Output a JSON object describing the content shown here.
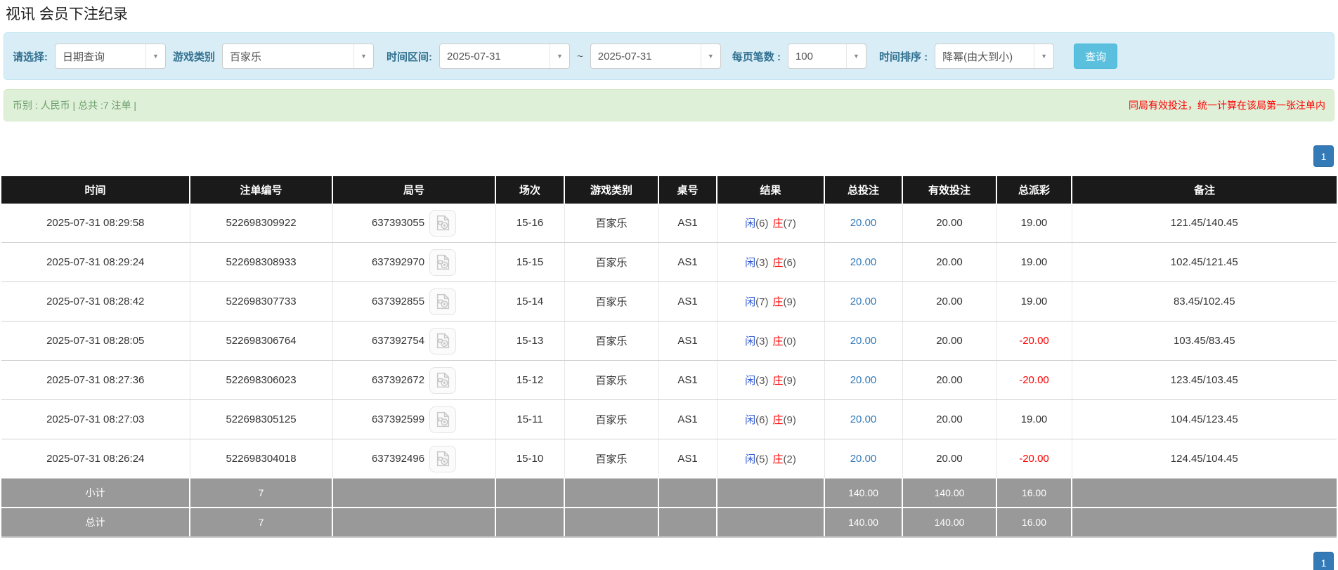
{
  "page": {
    "title": "视讯 会员下注纪录"
  },
  "filters": {
    "select_label": "请选择:",
    "query_type": "日期查询",
    "game_type_label": "游戏类别",
    "game_type": "百家乐",
    "date_range_label": "时间区间:",
    "date_from": "2025-07-31",
    "date_separator": "~",
    "date_to": "2025-07-31",
    "page_size_label": "每页笔数 :",
    "page_size": "100",
    "sort_label": "时间排序 :",
    "sort_value": "降幂(由大到小)",
    "search_label": "查询"
  },
  "summary": {
    "left": "币别 : 人民币 | 总共 :7 注单 |",
    "notice": "同局有效投注，统一计算在该局第一张注单内"
  },
  "pagination": {
    "page": "1"
  },
  "table": {
    "headers": [
      "时间",
      "注单编号",
      "局号",
      "场次",
      "游戏类别",
      "桌号",
      "结果",
      "总投注",
      "有效投注",
      "总派彩",
      "备注"
    ],
    "rows": [
      {
        "time": "2025-07-31 08:29:58",
        "bet_id": "522698309922",
        "round_id": "637393055",
        "session": "15-16",
        "game": "百家乐",
        "table_no": "AS1",
        "player": "闲",
        "player_pts": "(6)",
        "banker": "庄",
        "banker_pts": "(7)",
        "total_bet": "20.00",
        "valid_bet": "20.00",
        "payout": "19.00",
        "remark": "121.45/140.45"
      },
      {
        "time": "2025-07-31 08:29:24",
        "bet_id": "522698308933",
        "round_id": "637392970",
        "session": "15-15",
        "game": "百家乐",
        "table_no": "AS1",
        "player": "闲",
        "player_pts": "(3)",
        "banker": "庄",
        "banker_pts": "(6)",
        "total_bet": "20.00",
        "valid_bet": "20.00",
        "payout": "19.00",
        "remark": "102.45/121.45"
      },
      {
        "time": "2025-07-31 08:28:42",
        "bet_id": "522698307733",
        "round_id": "637392855",
        "session": "15-14",
        "game": "百家乐",
        "table_no": "AS1",
        "player": "闲",
        "player_pts": "(7)",
        "banker": "庄",
        "banker_pts": "(9)",
        "total_bet": "20.00",
        "valid_bet": "20.00",
        "payout": "19.00",
        "remark": "83.45/102.45"
      },
      {
        "time": "2025-07-31 08:28:05",
        "bet_id": "522698306764",
        "round_id": "637392754",
        "session": "15-13",
        "game": "百家乐",
        "table_no": "AS1",
        "player": "闲",
        "player_pts": "(3)",
        "banker": "庄",
        "banker_pts": "(0)",
        "total_bet": "20.00",
        "valid_bet": "20.00",
        "payout": "-20.00",
        "remark": "103.45/83.45"
      },
      {
        "time": "2025-07-31 08:27:36",
        "bet_id": "522698306023",
        "round_id": "637392672",
        "session": "15-12",
        "game": "百家乐",
        "table_no": "AS1",
        "player": "闲",
        "player_pts": "(3)",
        "banker": "庄",
        "banker_pts": "(9)",
        "total_bet": "20.00",
        "valid_bet": "20.00",
        "payout": "-20.00",
        "remark": "123.45/103.45"
      },
      {
        "time": "2025-07-31 08:27:03",
        "bet_id": "522698305125",
        "round_id": "637392599",
        "session": "15-11",
        "game": "百家乐",
        "table_no": "AS1",
        "player": "闲",
        "player_pts": "(6)",
        "banker": "庄",
        "banker_pts": "(9)",
        "total_bet": "20.00",
        "valid_bet": "20.00",
        "payout": "19.00",
        "remark": "104.45/123.45"
      },
      {
        "time": "2025-07-31 08:26:24",
        "bet_id": "522698304018",
        "round_id": "637392496",
        "session": "15-10",
        "game": "百家乐",
        "table_no": "AS1",
        "player": "闲",
        "player_pts": "(5)",
        "banker": "庄",
        "banker_pts": "(2)",
        "total_bet": "20.00",
        "valid_bet": "20.00",
        "payout": "-20.00",
        "remark": "124.45/104.45"
      }
    ],
    "subtotal": {
      "label": "小计",
      "count": "7",
      "total_bet": "140.00",
      "valid_bet": "140.00",
      "payout": "16.00"
    },
    "grand_total": {
      "label": "总计",
      "count": "7",
      "total_bet": "140.00",
      "valid_bet": "140.00",
      "payout": "16.00"
    }
  },
  "icons": {
    "video_icon": "video-replay-file",
    "caret_icon": "chevron-down"
  },
  "colors": {
    "accent_blue": "#337ab7",
    "search_button_blue": "#5bc0de",
    "filter_panel_bg": "#d9edf7",
    "summary_bar_bg": "#dff0d8",
    "table_header_bg": "#1a1a1a",
    "table_footer_bg": "#999999",
    "negative_red": "#ff0000",
    "player_blue": "#2e58d8",
    "banker_red": "#ff0000"
  }
}
